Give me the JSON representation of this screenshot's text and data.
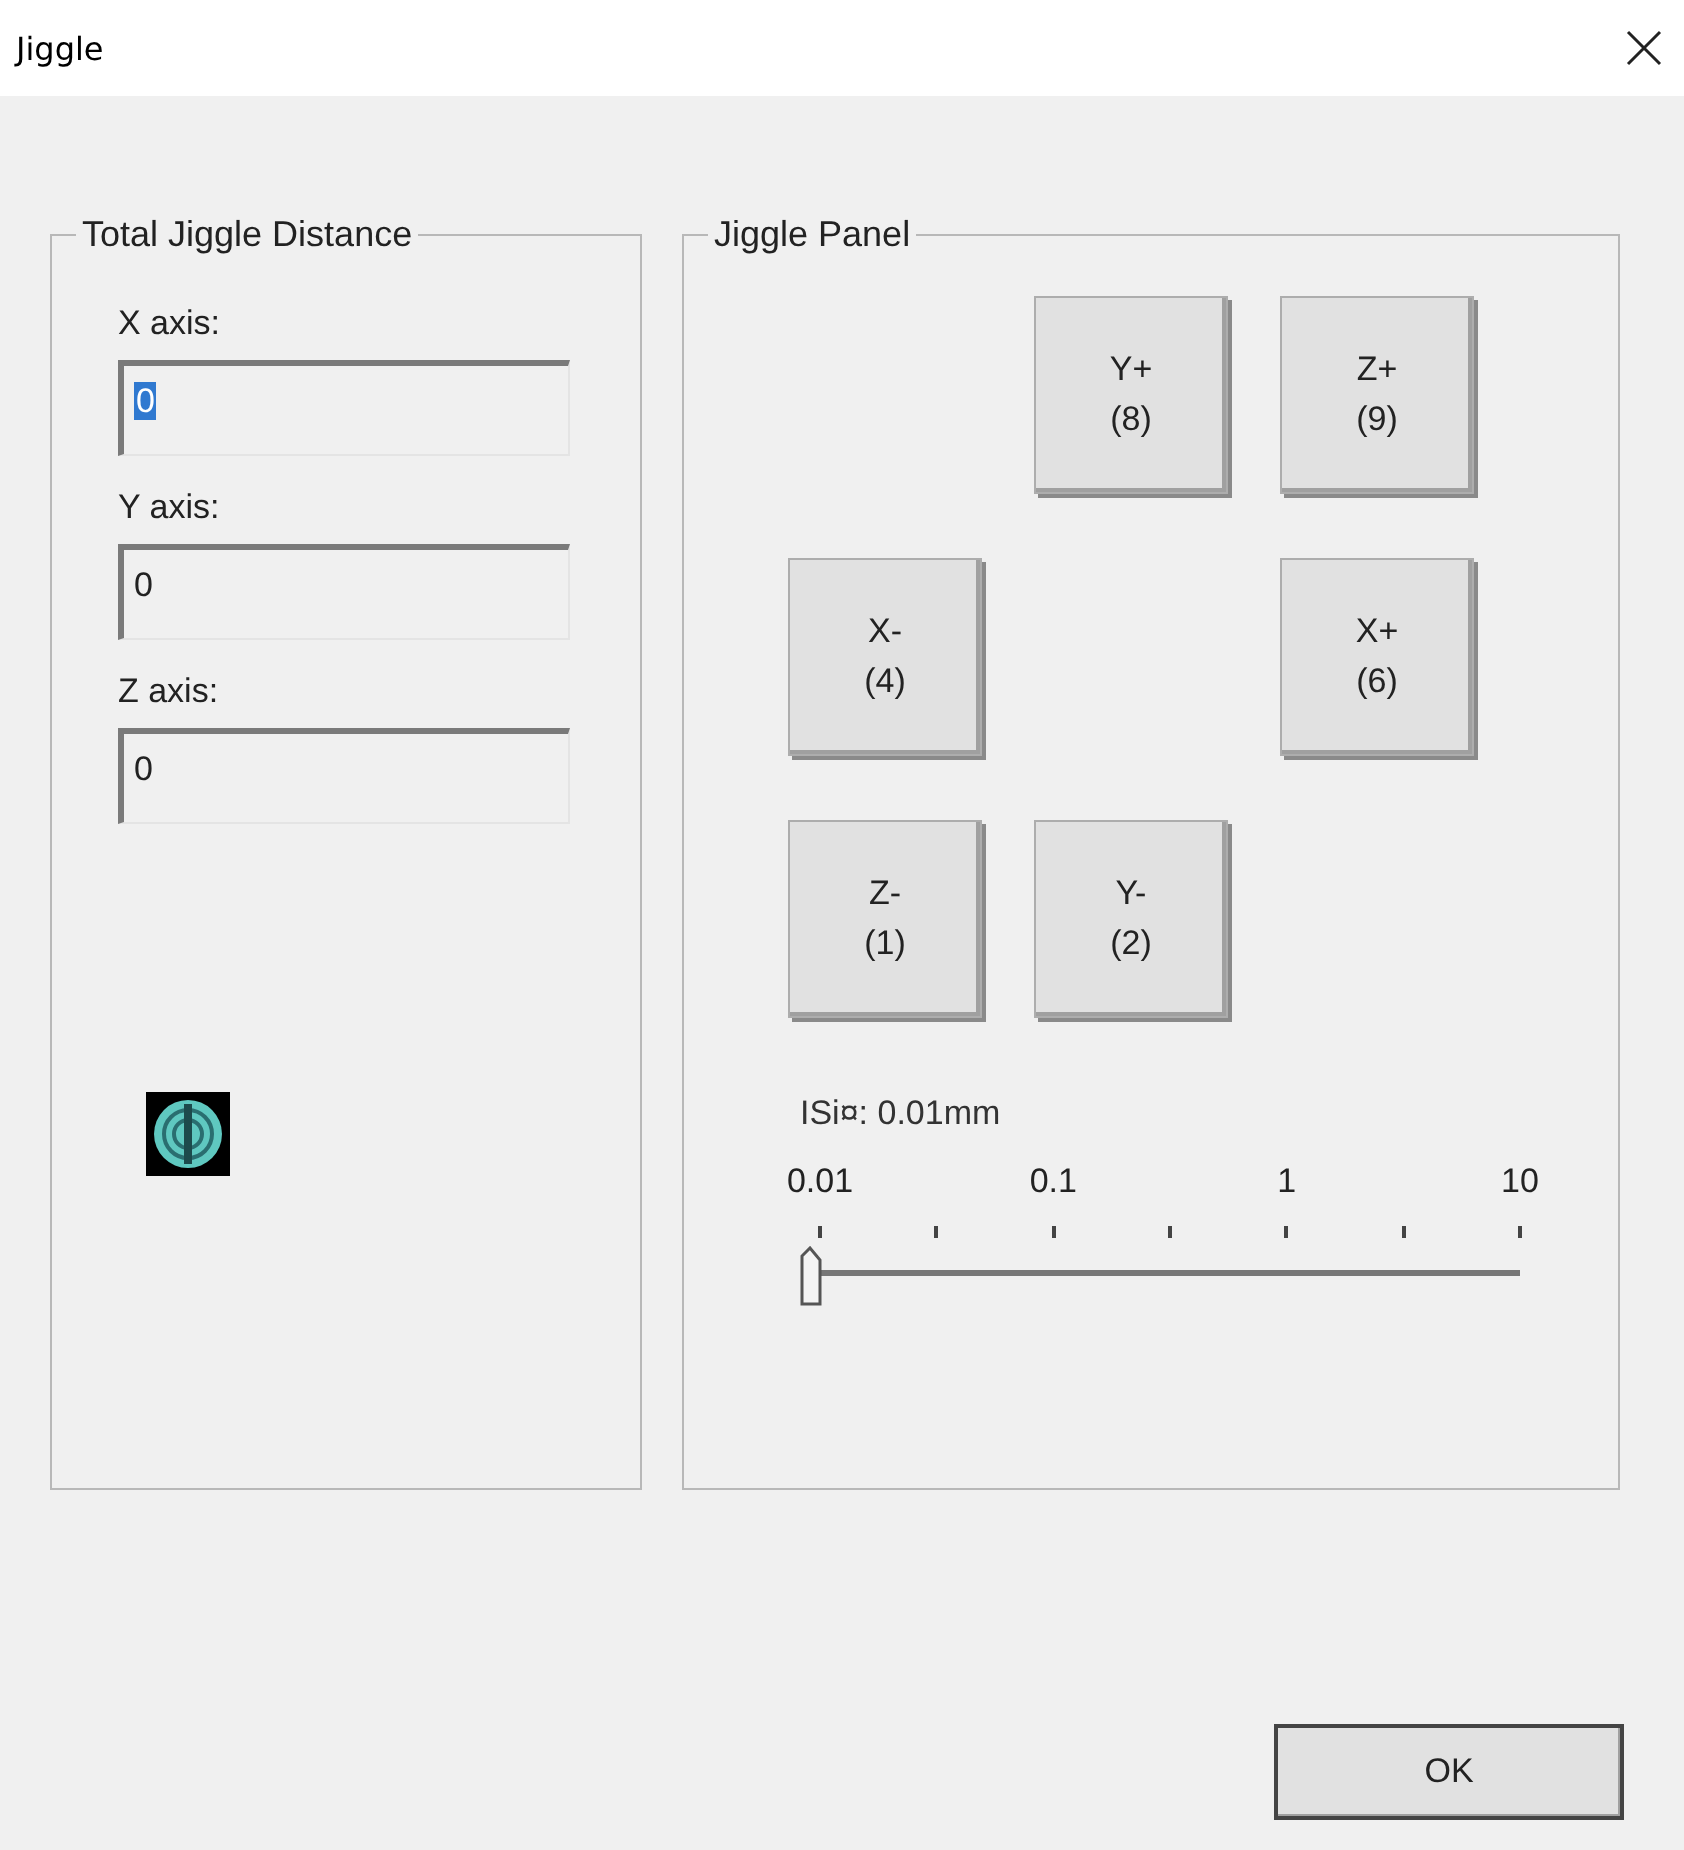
{
  "window": {
    "title": "Jiggle"
  },
  "distance": {
    "title": "Total Jiggle Distance",
    "fields": [
      {
        "label": "X axis:",
        "value": "0",
        "selected": true
      },
      {
        "label": "Y axis:",
        "value": "0",
        "selected": false
      },
      {
        "label": "Z axis:",
        "value": "0",
        "selected": false
      }
    ]
  },
  "panel": {
    "title": "Jiggle Panel",
    "buttons": [
      {
        "label": "Y+",
        "key": "(8)"
      },
      {
        "label": "Z+",
        "key": "(9)"
      },
      {
        "label": "X-",
        "key": "(4)"
      },
      {
        "label": "X+",
        "key": "(6)"
      },
      {
        "label": "Z-",
        "key": "(1)"
      },
      {
        "label": "Y-",
        "key": "(2)"
      }
    ],
    "step": {
      "reading": "ISi¤: 0.01mm",
      "scale": [
        "0.01",
        "0.1",
        "1",
        "10"
      ],
      "level": 0
    }
  },
  "buttons": [
    "OK"
  ]
}
